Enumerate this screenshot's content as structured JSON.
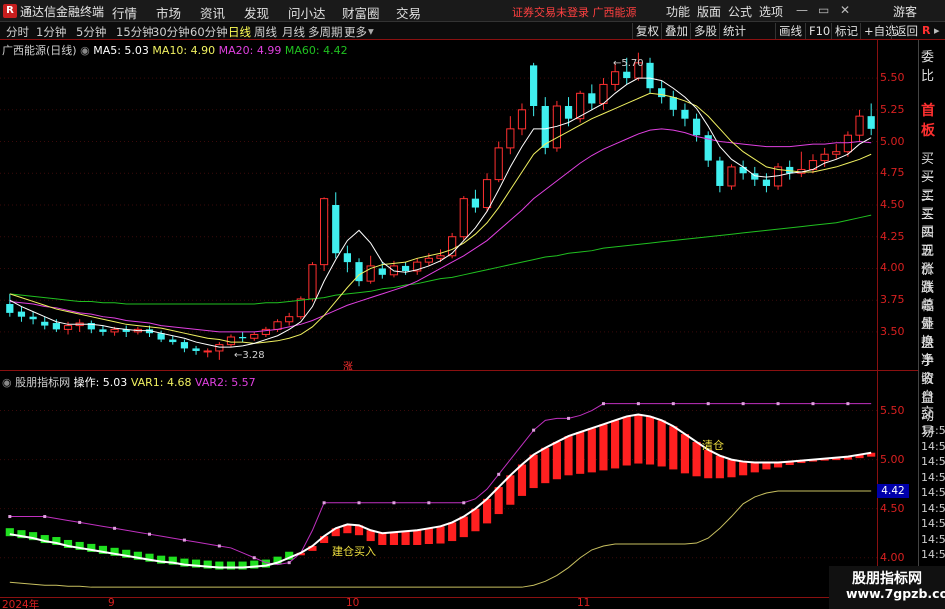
{
  "titlebar": {
    "app_name": "通达信金融终端",
    "menu": [
      "行情",
      "市场",
      "资讯",
      "发现",
      "问小达",
      "财富圈",
      "交易"
    ],
    "warning": "证券交易未登录  广西能源",
    "right": [
      "功能",
      "版面",
      "公式",
      "选项"
    ],
    "login": "游客",
    "logo": "R"
  },
  "periodbar": {
    "periods": [
      "分时",
      "1分钟",
      "5分钟",
      "15分钟",
      "30分钟",
      "60分钟",
      "日线",
      "周线",
      "月线",
      "多周期",
      "更多"
    ],
    "active": "日线",
    "tools": [
      "复权",
      "叠加",
      "多股",
      "统计",
      "画线",
      "F10",
      "标记",
      "+自选",
      "返回"
    ]
  },
  "main_chart": {
    "stock": "广西能源(日线)",
    "ma5_label": "MA5: 5.03",
    "ma10_label": "MA10: 4.90",
    "ma20_label": "MA20: 4.99",
    "ma60_label": "MA60: 4.42",
    "high_mark": "5.70",
    "low_mark": "3.28",
    "limit_tag": "涨",
    "y_labels": [
      "5.50",
      "5.25",
      "5.00",
      "4.75",
      "4.50",
      "4.25",
      "4.00",
      "3.75",
      "3.50"
    ],
    "colors": {
      "up": "#ff3030",
      "down": "#40f0f0",
      "ma5": "#ffffff",
      "ma10": "#f0f060",
      "ma20": "#e040e0",
      "ma60": "#20c020"
    }
  },
  "sub_chart": {
    "name": "股朋指标网",
    "op_label": "操作: 5.03",
    "var1_label": "VAR1: 4.68",
    "var2_label": "VAR2: 5.57",
    "signal_clear": "清仓",
    "signal_buy": "建仓买入",
    "y_labels": [
      "5.50",
      "5.00",
      "4.50",
      "4.00"
    ],
    "current_price": "4.42"
  },
  "xaxis": {
    "labels": [
      "2024年",
      "9",
      "10",
      "11"
    ]
  },
  "right_panel": {
    "top": "委比",
    "highlight": "首板",
    "items": [
      "买一",
      "买二",
      "买三",
      "买四",
      "买五",
      "现价",
      "涨跌",
      "涨幅",
      "总量",
      "外盘",
      "换手",
      "净资",
      "收益"
    ],
    "trade": [
      "自动",
      "交易"
    ],
    "times": [
      "14:5",
      "14:5",
      "14:5",
      "14:5",
      "14:5",
      "14:5",
      "14:5",
      "14:5",
      "14:5",
      "14:5",
      "14:5",
      "14:5"
    ]
  },
  "watermark": {
    "line1": "股朋指标网",
    "line2": "www.7gpzb.com"
  },
  "chart_data": {
    "type": "candlestick",
    "title": "广西能源(日线)",
    "ylim": [
      3.2,
      5.8
    ],
    "candles": [
      [
        3.72,
        3.65,
        3.8,
        3.62
      ],
      [
        3.66,
        3.62,
        3.7,
        3.58
      ],
      [
        3.62,
        3.6,
        3.66,
        3.56
      ],
      [
        3.58,
        3.55,
        3.62,
        3.52
      ],
      [
        3.57,
        3.52,
        3.6,
        3.5
      ],
      [
        3.52,
        3.55,
        3.58,
        3.48
      ],
      [
        3.55,
        3.57,
        3.6,
        3.5
      ],
      [
        3.57,
        3.52,
        3.59,
        3.49
      ],
      [
        3.52,
        3.5,
        3.55,
        3.47
      ],
      [
        3.5,
        3.52,
        3.54,
        3.47
      ],
      [
        3.52,
        3.5,
        3.55,
        3.46
      ],
      [
        3.5,
        3.52,
        3.54,
        3.48
      ],
      [
        3.52,
        3.49,
        3.55,
        3.46
      ],
      [
        3.49,
        3.44,
        3.51,
        3.42
      ],
      [
        3.44,
        3.42,
        3.47,
        3.4
      ],
      [
        3.42,
        3.37,
        3.44,
        3.34
      ],
      [
        3.37,
        3.35,
        3.39,
        3.32
      ],
      [
        3.35,
        3.35,
        3.37,
        3.3
      ],
      [
        3.35,
        3.4,
        3.42,
        3.28
      ],
      [
        3.4,
        3.46,
        3.48,
        3.38
      ],
      [
        3.46,
        3.45,
        3.5,
        3.42
      ],
      [
        3.45,
        3.48,
        3.5,
        3.43
      ],
      [
        3.48,
        3.52,
        3.54,
        3.46
      ],
      [
        3.52,
        3.58,
        3.6,
        3.5
      ],
      [
        3.58,
        3.62,
        3.65,
        3.55
      ],
      [
        3.62,
        3.76,
        3.78,
        3.6
      ],
      [
        3.76,
        4.03,
        4.05,
        3.74
      ],
      [
        4.03,
        4.55,
        4.56,
        3.98
      ],
      [
        4.5,
        4.12,
        4.6,
        4.08
      ],
      [
        4.12,
        4.05,
        4.18,
        3.97
      ],
      [
        4.05,
        3.9,
        4.08,
        3.86
      ],
      [
        3.9,
        4.02,
        4.1,
        3.88
      ],
      [
        4.0,
        3.95,
        4.05,
        3.92
      ],
      [
        3.95,
        4.02,
        4.06,
        3.93
      ],
      [
        4.02,
        3.98,
        4.05,
        3.95
      ],
      [
        3.98,
        4.05,
        4.08,
        3.95
      ],
      [
        4.05,
        4.08,
        4.12,
        4.02
      ],
      [
        4.08,
        4.1,
        4.15,
        4.05
      ],
      [
        4.1,
        4.25,
        4.28,
        4.08
      ],
      [
        4.25,
        4.55,
        4.57,
        4.22
      ],
      [
        4.55,
        4.48,
        4.62,
        4.44
      ],
      [
        4.48,
        4.7,
        4.75,
        4.45
      ],
      [
        4.7,
        4.95,
        5.0,
        4.68
      ],
      [
        4.95,
        5.1,
        5.2,
        4.9
      ],
      [
        5.1,
        5.25,
        5.3,
        5.05
      ],
      [
        5.6,
        5.28,
        5.62,
        5.2
      ],
      [
        5.28,
        4.95,
        5.35,
        4.9
      ],
      [
        4.95,
        5.28,
        5.32,
        4.92
      ],
      [
        5.28,
        5.18,
        5.35,
        5.12
      ],
      [
        5.18,
        5.38,
        5.4,
        5.15
      ],
      [
        5.38,
        5.3,
        5.45,
        5.25
      ],
      [
        5.3,
        5.45,
        5.5,
        5.25
      ],
      [
        5.45,
        5.55,
        5.62,
        5.4
      ],
      [
        5.55,
        5.5,
        5.66,
        5.45
      ],
      [
        5.5,
        5.62,
        5.7,
        5.48
      ],
      [
        5.62,
        5.42,
        5.66,
        5.38
      ],
      [
        5.42,
        5.35,
        5.48,
        5.3
      ],
      [
        5.35,
        5.25,
        5.4,
        5.2
      ],
      [
        5.25,
        5.18,
        5.3,
        5.12
      ],
      [
        5.18,
        5.05,
        5.22,
        5.0
      ],
      [
        5.05,
        4.85,
        5.08,
        4.8
      ],
      [
        4.85,
        4.65,
        4.88,
        4.6
      ],
      [
        4.65,
        4.8,
        4.82,
        4.62
      ],
      [
        4.8,
        4.75,
        4.85,
        4.7
      ],
      [
        4.75,
        4.7,
        4.8,
        4.65
      ],
      [
        4.7,
        4.65,
        4.75,
        4.6
      ],
      [
        4.65,
        4.8,
        4.83,
        4.62
      ],
      [
        4.8,
        4.75,
        4.85,
        4.7
      ],
      [
        4.75,
        4.78,
        4.92,
        4.72
      ],
      [
        4.78,
        4.85,
        4.9,
        4.75
      ],
      [
        4.85,
        4.9,
        4.95,
        4.8
      ],
      [
        4.9,
        4.92,
        4.98,
        4.86
      ],
      [
        4.92,
        5.05,
        5.08,
        4.88
      ],
      [
        5.05,
        5.2,
        5.25,
        5.0
      ],
      [
        5.2,
        5.1,
        5.3,
        5.05
      ]
    ],
    "ma5": [
      3.75,
      3.7,
      3.66,
      3.62,
      3.58,
      3.56,
      3.56,
      3.56,
      3.55,
      3.53,
      3.52,
      3.51,
      3.51,
      3.49,
      3.47,
      3.45,
      3.42,
      3.4,
      3.38,
      3.38,
      3.39,
      3.41,
      3.44,
      3.47,
      3.52,
      3.58,
      3.7,
      3.9,
      4.07,
      4.22,
      4.3,
      4.2,
      4.05,
      3.98,
      3.97,
      3.99,
      4.02,
      4.06,
      4.12,
      4.22,
      4.32,
      4.45,
      4.62,
      4.8,
      4.96,
      5.1,
      5.1,
      5.12,
      5.15,
      5.2,
      5.25,
      5.3,
      5.38,
      5.45,
      5.5,
      5.5,
      5.48,
      5.42,
      5.35,
      5.26,
      5.12,
      4.96,
      4.86,
      4.8,
      4.73,
      4.72,
      4.73,
      4.75,
      4.76,
      4.78,
      4.83,
      4.86,
      4.9,
      4.98,
      5.03
    ],
    "ma10": [
      3.8,
      3.77,
      3.74,
      3.71,
      3.68,
      3.66,
      3.64,
      3.62,
      3.6,
      3.58,
      3.56,
      3.55,
      3.54,
      3.53,
      3.51,
      3.49,
      3.47,
      3.45,
      3.44,
      3.42,
      3.42,
      3.41,
      3.42,
      3.43,
      3.45,
      3.48,
      3.54,
      3.63,
      3.74,
      3.85,
      3.95,
      4.0,
      4.03,
      4.04,
      4.05,
      4.08,
      4.1,
      4.12,
      4.15,
      4.2,
      4.27,
      4.36,
      4.48,
      4.62,
      4.76,
      4.9,
      4.98,
      5.03,
      5.08,
      5.13,
      5.18,
      5.22,
      5.26,
      5.3,
      5.34,
      5.38,
      5.37,
      5.35,
      5.32,
      5.28,
      5.2,
      5.1,
      5.0,
      4.92,
      4.86,
      4.8,
      4.78,
      4.77,
      4.76,
      4.76,
      4.78,
      4.8,
      4.83,
      4.86,
      4.9
    ],
    "ma20": [
      3.74,
      3.73,
      3.72,
      3.7,
      3.69,
      3.67,
      3.65,
      3.64,
      3.62,
      3.61,
      3.59,
      3.58,
      3.57,
      3.55,
      3.54,
      3.53,
      3.52,
      3.51,
      3.5,
      3.5,
      3.5,
      3.5,
      3.51,
      3.52,
      3.54,
      3.56,
      3.59,
      3.63,
      3.67,
      3.71,
      3.74,
      3.77,
      3.8,
      3.83,
      3.86,
      3.9,
      3.95,
      4.0,
      4.05,
      4.1,
      4.16,
      4.22,
      4.3,
      4.38,
      4.46,
      4.55,
      4.62,
      4.69,
      4.76,
      4.83,
      4.89,
      4.94,
      4.98,
      5.02,
      5.06,
      5.09,
      5.1,
      5.09,
      5.07,
      5.04,
      5.02,
      5.0,
      4.99,
      4.98,
      4.97,
      4.96,
      4.96,
      4.96,
      4.97,
      4.98,
      4.98,
      4.99,
      4.99,
      5.0,
      4.99
    ],
    "ma60": [
      3.8,
      3.79,
      3.78,
      3.77,
      3.76,
      3.75,
      3.74,
      3.74,
      3.73,
      3.73,
      3.72,
      3.72,
      3.72,
      3.72,
      3.72,
      3.72,
      3.72,
      3.72,
      3.72,
      3.72,
      3.72,
      3.72,
      3.73,
      3.73,
      3.74,
      3.75,
      3.76,
      3.77,
      3.79,
      3.8,
      3.81,
      3.82,
      3.84,
      3.85,
      3.87,
      3.88,
      3.9,
      3.92,
      3.93,
      3.95,
      3.97,
      3.99,
      4.01,
      4.03,
      4.05,
      4.07,
      4.09,
      4.1,
      4.12,
      4.13,
      4.14,
      4.16,
      4.17,
      4.18,
      4.19,
      4.2,
      4.21,
      4.22,
      4.23,
      4.24,
      4.25,
      4.26,
      4.27,
      4.28,
      4.29,
      4.3,
      4.31,
      4.32,
      4.33,
      4.34,
      4.35,
      4.36,
      4.38,
      4.4,
      4.42
    ],
    "sub": {
      "ylim": [
        3.6,
        5.75
      ],
      "op": [
        4.24,
        4.22,
        4.2,
        4.17,
        4.15,
        4.12,
        4.1,
        4.08,
        4.06,
        4.04,
        4.02,
        4.0,
        3.98,
        3.96,
        3.95,
        3.93,
        3.92,
        3.91,
        3.9,
        3.9,
        3.9,
        3.91,
        3.92,
        3.95,
        4.0,
        4.05,
        4.12,
        4.22,
        4.3,
        4.34,
        4.33,
        4.28,
        4.25,
        4.26,
        4.27,
        4.28,
        4.3,
        4.32,
        4.36,
        4.42,
        4.5,
        4.6,
        4.72,
        4.84,
        4.95,
        5.05,
        5.12,
        5.18,
        5.24,
        5.28,
        5.32,
        5.36,
        5.4,
        5.44,
        5.46,
        5.44,
        5.4,
        5.34,
        5.26,
        5.18,
        5.1,
        5.04,
        5.0,
        4.98,
        4.97,
        4.97,
        4.97,
        4.98,
        4.99,
        5.0,
        5.01,
        5.02,
        5.03,
        5.05,
        5.07
      ],
      "var1": [
        3.75,
        3.74,
        3.73,
        3.72,
        3.72,
        3.71,
        3.71,
        3.7,
        3.7,
        3.7,
        3.7,
        3.7,
        3.7,
        3.7,
        3.7,
        3.7,
        3.7,
        3.7,
        3.7,
        3.7,
        3.7,
        3.7,
        3.7,
        3.7,
        3.7,
        3.7,
        3.7,
        3.7,
        3.7,
        3.7,
        3.7,
        3.7,
        3.7,
        3.7,
        3.7,
        3.7,
        3.7,
        3.7,
        3.7,
        3.7,
        3.7,
        3.7,
        3.7,
        3.7,
        3.7,
        3.72,
        3.76,
        3.82,
        3.9,
        4.0,
        4.08,
        4.12,
        4.14,
        4.14,
        4.14,
        4.14,
        4.14,
        4.14,
        4.14,
        4.15,
        4.2,
        4.3,
        4.42,
        4.55,
        4.62,
        4.66,
        4.68,
        4.68,
        4.68,
        4.68,
        4.68,
        4.68,
        4.68,
        4.68,
        4.68
      ],
      "var2": [
        4.42,
        4.42,
        4.42,
        4.42,
        4.4,
        4.38,
        4.36,
        4.34,
        4.32,
        4.3,
        4.28,
        4.26,
        4.24,
        4.22,
        4.2,
        4.18,
        4.16,
        4.14,
        4.12,
        4.1,
        4.05,
        4.0,
        3.95,
        3.93,
        3.95,
        4.05,
        4.28,
        4.56,
        4.56,
        4.56,
        4.56,
        4.56,
        4.56,
        4.56,
        4.56,
        4.56,
        4.56,
        4.56,
        4.56,
        4.56,
        4.6,
        4.7,
        4.85,
        5.0,
        5.15,
        5.3,
        5.4,
        5.42,
        5.42,
        5.45,
        5.5,
        5.57,
        5.57,
        5.57,
        5.57,
        5.57,
        5.57,
        5.57,
        5.57,
        5.57,
        5.57,
        5.57,
        5.57,
        5.57,
        5.57,
        5.57,
        5.57,
        5.57,
        5.57,
        5.57,
        5.57,
        5.57,
        5.57,
        5.57,
        5.57
      ],
      "bars": [
        -0.1,
        -0.12,
        -0.14,
        -0.16,
        -0.18,
        -0.2,
        -0.22,
        -0.24,
        -0.26,
        -0.28,
        -0.3,
        -0.32,
        -0.33,
        -0.34,
        -0.35,
        -0.36,
        -0.37,
        -0.38,
        -0.38,
        -0.38,
        -0.37,
        -0.35,
        -0.32,
        -0.28,
        -0.22,
        0.05,
        0.1,
        0.14,
        0.16,
        0.18,
        0.2,
        0.22,
        0.24,
        0.26,
        0.28,
        0.3,
        0.32,
        0.35,
        0.38,
        0.42,
        0.46,
        0.5,
        0.55,
        0.6,
        0.64,
        0.68,
        0.72,
        0.76,
        0.8,
        0.85,
        0.9,
        0.94,
        0.98,
        1.0,
        1.0,
        0.98,
        0.94,
        0.88,
        0.8,
        0.7,
        0.58,
        0.46,
        0.36,
        0.28,
        0.2,
        0.14,
        0.1,
        0.07,
        0.05,
        0.04,
        0.04,
        0.05,
        0.06,
        0.07,
        0.08
      ]
    }
  }
}
